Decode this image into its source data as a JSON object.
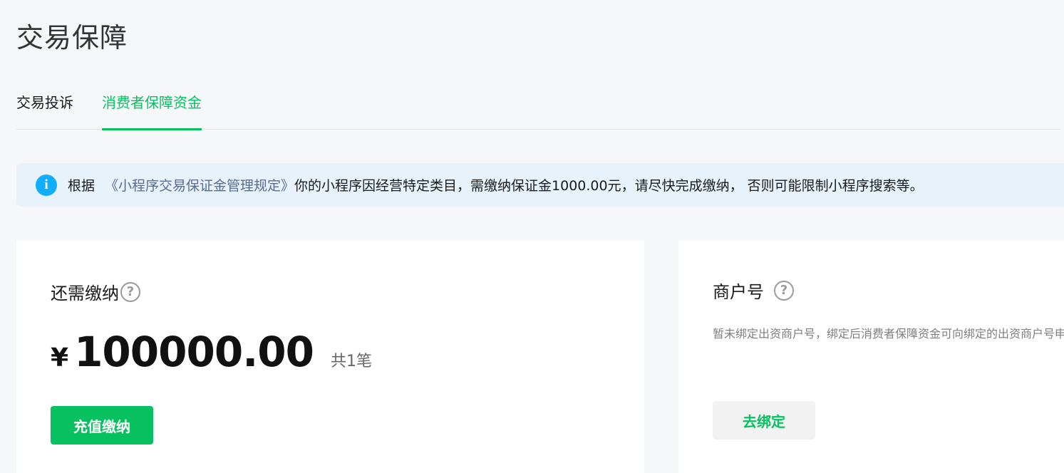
{
  "page": {
    "title": "交易保障"
  },
  "tabs": [
    {
      "label": "交易投诉",
      "active": false
    },
    {
      "label": "消费者保障资金",
      "active": true
    }
  ],
  "notice": {
    "icon": "info-icon",
    "prefix": "根据",
    "link": "《小程序交易保证金管理规定》",
    "text": "你的小程序因经营特定类目，需缴纳保证金1000.00元，请尽快完成缴纳， 否则可能限制小程序搜索等。"
  },
  "payment_card": {
    "label": "还需缴纳",
    "help_icon": "question-circle-icon",
    "currency": "¥",
    "amount": "100000.00",
    "count": "共1笔",
    "button": "充值缴纳"
  },
  "merchant_card": {
    "label": "商户号",
    "help_icon": "question-circle-icon",
    "description": "暂未绑定出资商户号，绑定后消费者保障资金可向绑定的出资商户号申请。",
    "button": "去绑定"
  },
  "colors": {
    "accent": "#07c160",
    "link": "#576b95",
    "info": "#10aeff",
    "notice_bg": "#e7f2fb",
    "page_bg": "#f6f7f9"
  }
}
